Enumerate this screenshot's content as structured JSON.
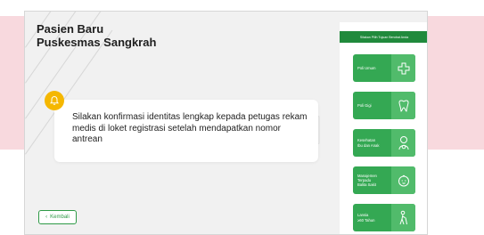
{
  "header": {
    "title_line1": "Pasien Baru",
    "title_line2": "Puskesmas Sangkrah"
  },
  "message": {
    "text": "Silakan konfirmasi identitas lengkap kepada petugas rekam medis di loket registrasi setelah mendapatkan nomor antrean"
  },
  "back_button": {
    "label": "Kembali"
  },
  "panel": {
    "header": "Silakan Pilih Tujuan Berobat Anda",
    "items": [
      {
        "label": "Poli Umum",
        "icon": "medical-cross-icon"
      },
      {
        "label": "Poli Gigi",
        "icon": "tooth-icon"
      },
      {
        "label": "Kesehatan\nIbu dan Anak",
        "icon": "mother-child-icon"
      },
      {
        "label": "Manajemen\nTerpadu\nBalita Sakit",
        "icon": "baby-icon"
      },
      {
        "label": "Lansia\n≥60 Tahun",
        "icon": "elderly-icon"
      }
    ]
  },
  "colors": {
    "accent_green": "#34a853",
    "header_green": "#208a3c",
    "bell_yellow": "#f5b700",
    "pink_background": "#f8d9de"
  }
}
